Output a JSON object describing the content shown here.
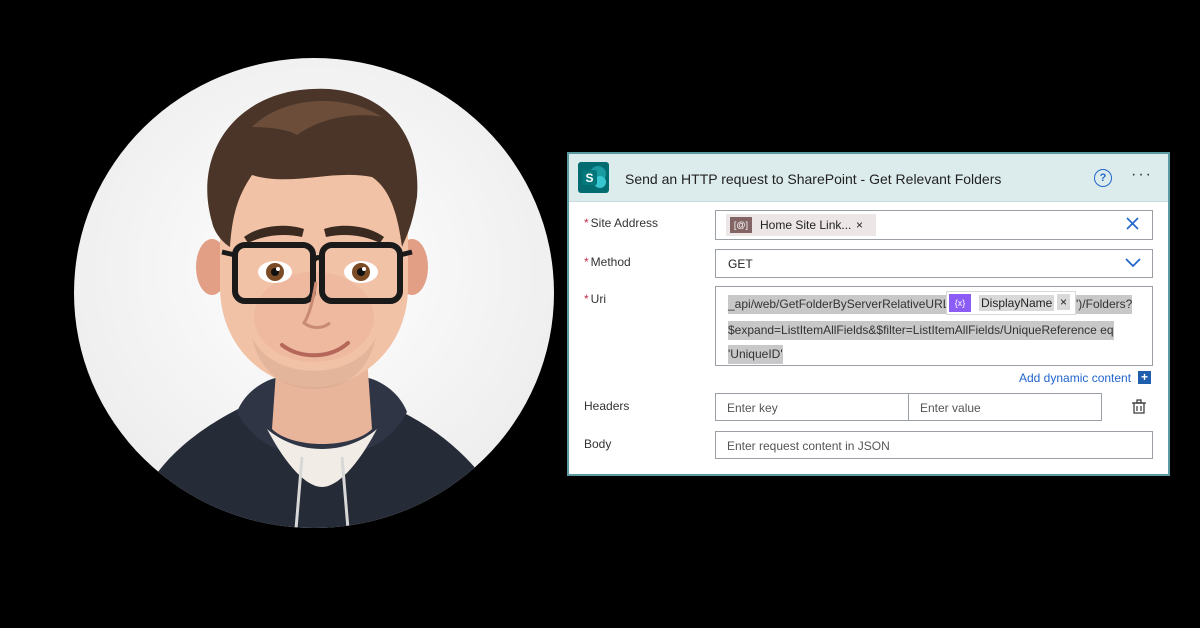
{
  "card": {
    "title": "Send an HTTP request to SharePoint - Get Relevant Folders",
    "logo_letter": "S",
    "help_glyph": "?",
    "more_glyph": "···"
  },
  "fields": {
    "site_address": {
      "label": "Site Address",
      "required_mark": "*",
      "token_text": "Home Site Link...",
      "token_icon": "[@]"
    },
    "method": {
      "label": "Method",
      "required_mark": "*",
      "value": "GET"
    },
    "uri": {
      "label": "Uri",
      "required_mark": "*",
      "line1_prefix": "_api/web/GetFolderByServerRelativeURL('",
      "line1_suffix": "')/Folders?",
      "line2": "$expand=ListItemAllFields&$filter=ListItemAllFields/UniqueReference eq",
      "line3": "'UniqueID'",
      "dynamic_token": "DisplayName",
      "dynamic_icon": "{x}"
    },
    "add_dynamic_content": "Add dynamic content",
    "add_plus": "+",
    "headers": {
      "label": "Headers",
      "key_placeholder": "Enter key",
      "value_placeholder": "Enter value"
    },
    "body": {
      "label": "Body",
      "placeholder": "Enter request content in JSON"
    },
    "close_glyph": "×"
  },
  "colors": {
    "header_bg": "#dcebeb",
    "border": "#5a9aa0",
    "sharepoint": "#036c70",
    "link": "#2266cc",
    "required": "#c4314b",
    "token_purple": "#8b5cf6"
  }
}
